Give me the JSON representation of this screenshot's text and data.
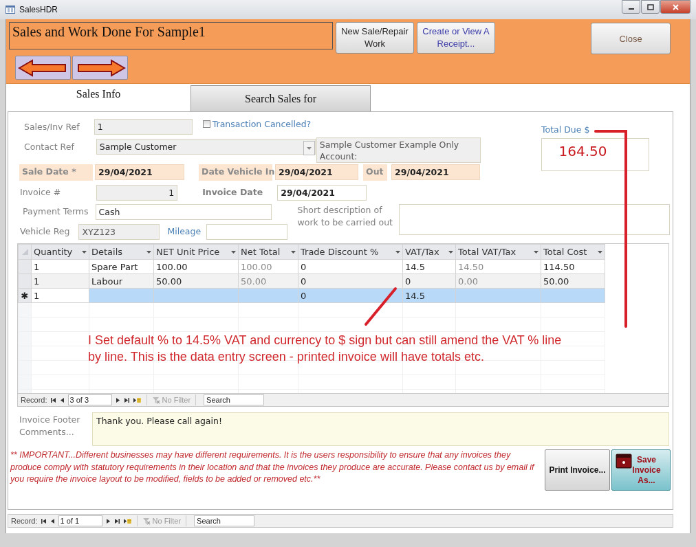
{
  "window": {
    "title": "SalesHDR"
  },
  "header": {
    "title": "Sales and Work Done For Sample1",
    "buttons": [
      {
        "label": "New Sale/Repair Work",
        "kind": "plain"
      },
      {
        "label": "Create or View A Receipt...",
        "kind": "link"
      }
    ],
    "close_button": "Close"
  },
  "tabs": [
    {
      "label": "Sales Info",
      "selected": true
    },
    {
      "label": "Search Sales for",
      "selected": false
    }
  ],
  "form": {
    "sales_inv_ref": {
      "label": "Sales/Inv Ref",
      "value": "1"
    },
    "transaction_cancelled": {
      "label": "Transaction Cancelled?",
      "checked": false
    },
    "contact_ref": {
      "label": "Contact Ref",
      "value": "Sample Customer",
      "info": "Sample Customer Example Only Account:"
    },
    "sale_date": {
      "label": "Sale Date *",
      "value": "29/04/2021"
    },
    "date_vehicle_in": {
      "label": "Date Vehicle In",
      "value": "29/04/2021"
    },
    "out": {
      "label": "Out",
      "value": "29/04/2021"
    },
    "invoice_number": {
      "label": "Invoice #",
      "value": "1"
    },
    "invoice_date": {
      "label": "Invoice Date",
      "value": "29/04/2021"
    },
    "payment_terms": {
      "label": "Payment Terms",
      "value": "Cash"
    },
    "short_description": {
      "label": "Short description of work to be carried out"
    },
    "vehicle_reg": {
      "label": "Vehicle Reg",
      "value": "XYZ123"
    },
    "mileage": {
      "label": "Mileage"
    },
    "total_due": {
      "label": "Total Due $",
      "value": "164.50"
    }
  },
  "line_items": {
    "columns": [
      "Quantity",
      "Details",
      "NET Unit Price",
      "Net Total",
      "Trade Discount %",
      "VAT/Tax",
      "Total VAT/Tax",
      "Total Cost"
    ],
    "rows": [
      {
        "kind": "data",
        "selected": false,
        "cells": [
          "1",
          "Spare Part",
          "100.00",
          "100.00",
          "0",
          "14.5",
          "14.50",
          "114.50"
        ]
      },
      {
        "kind": "data",
        "selected": false,
        "cells": [
          "1",
          "Labour",
          "50.00",
          "50.00",
          "0",
          "0",
          "0.00",
          "50.00"
        ]
      },
      {
        "kind": "new",
        "selected": true,
        "row_selector": "✱",
        "cells": [
          "1",
          "",
          "",
          "",
          "0",
          "14.5",
          "",
          ""
        ]
      }
    ],
    "record_nav": {
      "label": "Record:",
      "position": "3 of 3",
      "filter": "No Filter",
      "search": "Search"
    }
  },
  "annotation": {
    "text": "I Set default % to 14.5% VAT and currency to $ sign but can still amend the VAT % line by line. This is the data entry screen - printed invoice will have totals etc."
  },
  "footer": {
    "label": "Invoice Footer Comments...",
    "value": "Thank you. Please call again!"
  },
  "disclaimer": "** IMPORTANT...Different businesses may have different requirements. It is the users responsibility to ensure that any invoices they produce comply with statutory requirements in their location and that the invoices they produce are accurate. Please contact us by email if you require the invoice layout to be modified, fields to be added or removed etc.**",
  "action_buttons": [
    {
      "label": "Print Invoice...",
      "kind": "plain"
    },
    {
      "label": "Save Invoice As...",
      "kind": "save"
    }
  ],
  "record_nav": {
    "label": "Record:",
    "position": "1 of 1",
    "filter": "No Filter",
    "search": "Search"
  }
}
